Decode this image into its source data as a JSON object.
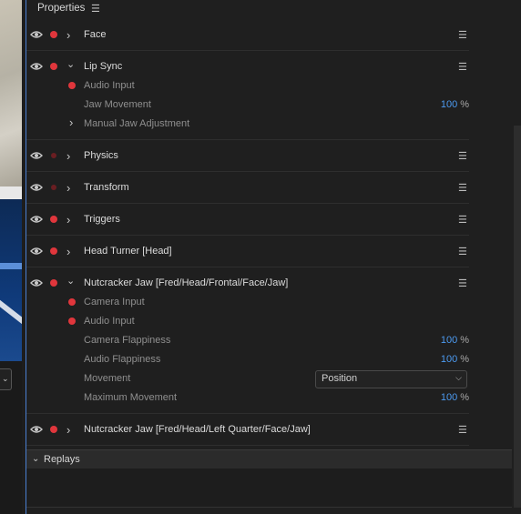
{
  "panel": {
    "title": "Properties"
  },
  "behaviors": [
    {
      "name": "Face",
      "expanded": false
    },
    {
      "name": "Lip Sync",
      "expanded": true,
      "sub": [
        {
          "type": "input",
          "label": "Audio Input"
        },
        {
          "type": "param",
          "label": "Jaw Movement",
          "value": "100",
          "unit": "%"
        },
        {
          "type": "group",
          "label": "Manual Jaw Adjustment"
        }
      ]
    },
    {
      "name": "Physics",
      "expanded": false
    },
    {
      "name": "Transform",
      "expanded": false
    },
    {
      "name": "Triggers",
      "expanded": false
    },
    {
      "name": "Head Turner [Head]",
      "expanded": false
    },
    {
      "name": "Nutcracker Jaw [Fred/Head/Frontal/Face/Jaw]",
      "expanded": true,
      "sub": [
        {
          "type": "input",
          "label": "Camera Input"
        },
        {
          "type": "input",
          "label": "Audio Input"
        },
        {
          "type": "param",
          "label": "Camera Flappiness",
          "value": "100",
          "unit": "%"
        },
        {
          "type": "param",
          "label": "Audio Flappiness",
          "value": "100",
          "unit": "%"
        },
        {
          "type": "select",
          "label": "Movement",
          "value": "Position"
        },
        {
          "type": "param",
          "label": "Maximum Movement",
          "value": "100",
          "unit": "%"
        }
      ]
    },
    {
      "name": "Nutcracker Jaw [Fred/Head/Left Quarter/Face/Jaw]",
      "expanded": false
    }
  ],
  "replays": {
    "title": "Replays"
  },
  "icons": {
    "visibility": "eye-icon",
    "armed": "record-dot-icon",
    "menu": "hamburger-icon"
  },
  "colors": {
    "accent": "#4c9af0",
    "record": "#e0363c"
  }
}
